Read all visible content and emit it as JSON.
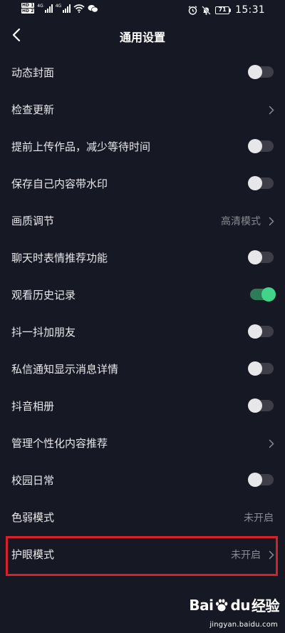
{
  "status_bar": {
    "sim1_label": "HD 1",
    "sim2_label": "HD 2",
    "network1": "4G",
    "network2": "4G",
    "battery_level": "71",
    "time": "15:31",
    "icons": [
      "signal-icon",
      "wifi-icon",
      "wechat-icon",
      "alarm-icon",
      "mute-icon",
      "battery-icon"
    ]
  },
  "header": {
    "title": "通用设置",
    "back_icon": "chevron-left-icon"
  },
  "settings": [
    {
      "label": "动态封面",
      "control": "toggle",
      "on": false
    },
    {
      "label": "检查更新",
      "control": "chevron"
    },
    {
      "label": "提前上传作品，减少等待时间",
      "control": "toggle",
      "on": false
    },
    {
      "label": "保存自己内容带水印",
      "control": "toggle",
      "on": false
    },
    {
      "label": "画质调节",
      "control": "chevron",
      "value": "高清模式"
    },
    {
      "label": "聊天时表情推荐功能",
      "control": "toggle",
      "on": false
    },
    {
      "label": "观看历史记录",
      "control": "toggle",
      "on": true
    },
    {
      "label": "抖一抖加朋友",
      "control": "toggle",
      "on": false
    },
    {
      "label": "私信通知显示消息详情",
      "control": "toggle",
      "on": false
    },
    {
      "label": "抖音相册",
      "control": "toggle",
      "on": false
    },
    {
      "label": "管理个性化内容推荐",
      "control": "chevron"
    },
    {
      "label": "校园日常",
      "control": "toggle",
      "on": false
    },
    {
      "label": "色弱模式",
      "control": "value",
      "value": "未开启"
    },
    {
      "label": "护眼模式",
      "control": "chevron",
      "value": "未开启",
      "highlighted": true
    }
  ],
  "colors": {
    "background": "#161823",
    "toggle_on": "#40d58a",
    "toggle_off_track": "#3d3e48",
    "highlight_border": "#d7202a",
    "secondary_text": "#8a8b93"
  },
  "watermark": {
    "logo_text_left": "Bai",
    "logo_text_right": "du",
    "logo_suffix": "经验",
    "url": "jingyan.baidu.com"
  }
}
